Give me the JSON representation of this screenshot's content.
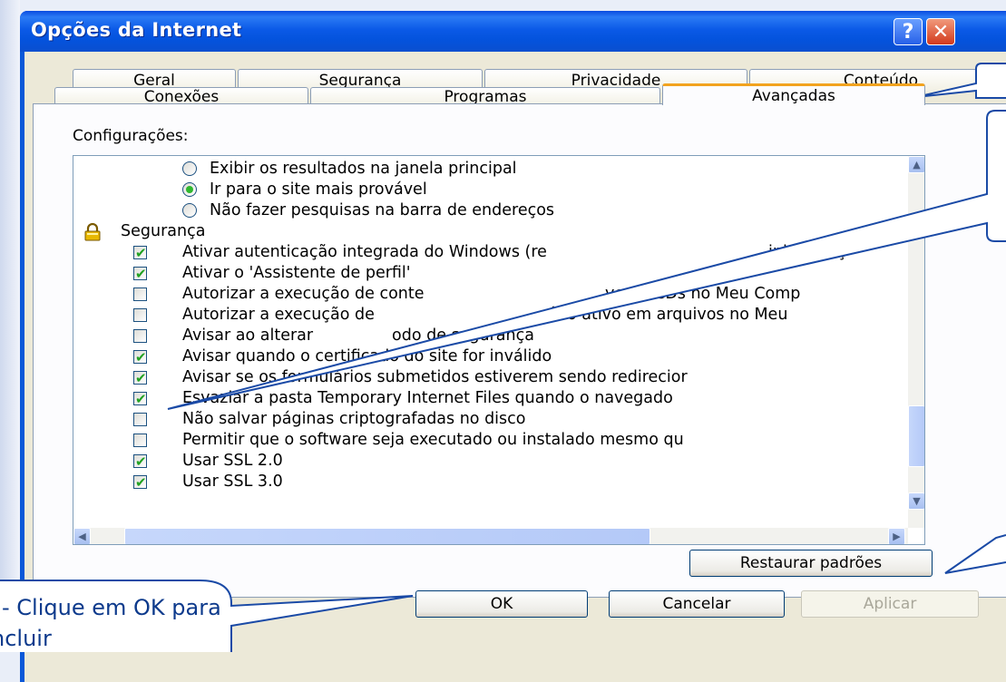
{
  "window": {
    "title": "Opções da Internet",
    "help_glyph": "?",
    "close_glyph": "✕"
  },
  "tabs_row1": [
    "Geral",
    "Segurança",
    "Privacidade",
    "Conteúdo"
  ],
  "tabs_row2": [
    "Conexões",
    "Programas",
    "Avançadas"
  ],
  "active_tab": "Avançadas",
  "settings": {
    "label": "Configurações:",
    "items": [
      {
        "type": "radio",
        "checked": false,
        "label": "Exibir os resultados na janela principal"
      },
      {
        "type": "radio",
        "checked": true,
        "label": "Ir para o site mais provável"
      },
      {
        "type": "radio",
        "checked": false,
        "label": "Não fazer pesquisas na barra de endereços"
      },
      {
        "type": "group",
        "icon": "lock-icon",
        "label": "Segurança"
      },
      {
        "type": "checkbox",
        "checked": true,
        "label": "Ativar autenticação integrada do Windows (re"
      },
      {
        "type": "checkbox",
        "checked": true,
        "label": "Ativar o 'Assistente de perfil'"
      },
      {
        "type": "checkbox",
        "checked": false,
        "label": "Autorizar a execução de conte"
      },
      {
        "type": "checkbox",
        "checked": false,
        "label": "Autorizar a execução de"
      },
      {
        "type": "checkbox",
        "checked": false,
        "label": "Avisar ao alterar"
      },
      {
        "type": "checkbox",
        "checked": true,
        "label": "Avisar quando o certificado do site for inválido"
      },
      {
        "type": "checkbox",
        "checked": true,
        "label": "Avisar se os formulários submetidos estiverem sendo redirecior"
      },
      {
        "type": "checkbox",
        "checked": true,
        "label": "Esvaziar a pasta Temporary Internet Files quando o navegado"
      },
      {
        "type": "checkbox",
        "checked": false,
        "label": "Não salvar páginas criptografadas no disco"
      },
      {
        "type": "checkbox",
        "checked": false,
        "label": "Permitir que o software seja executado ou instalado mesmo qu"
      },
      {
        "type": "checkbox",
        "checked": true,
        "label": "Usar SSL 2.0"
      },
      {
        "type": "checkbox",
        "checked": true,
        "label": "Usar SSL 3.0"
      }
    ],
    "partial_texts": {
      "r4_tail": "inicializaç",
      "r6_tail": "vo de CDs no Meu Comp",
      "r7_tail": "eúdo ativo em arquivos no Meu",
      "r8_tail": "odo de segurança"
    }
  },
  "buttons": {
    "restore": "Restaurar padrões",
    "ok": "OK",
    "cancel": "Cancelar",
    "apply": "Aplicar"
  },
  "callout": {
    "line1": "- Clique em OK para",
    "line2": "ncluir"
  },
  "colors": {
    "titlebar": "#0a58d8",
    "callout_border": "#1a4aa6",
    "callout_text": "#0d3a8c",
    "active_tab_accent": "#f2a31e",
    "check_green": "#21a121"
  }
}
